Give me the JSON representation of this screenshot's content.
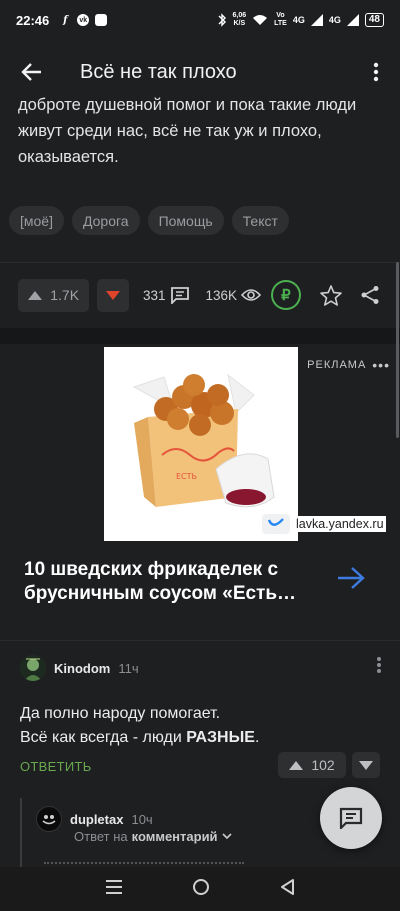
{
  "status_bar": {
    "time": "22:46",
    "speed": "6,06",
    "speed_unit": "K/S",
    "volte_top": "Vo",
    "volte_bottom": "LTE",
    "net1": "4G",
    "net2": "4G",
    "battery": "48"
  },
  "header": {
    "title": "Всё не так плохо"
  },
  "post": {
    "text": "доброте душевной помог и пока такие люди живут среди нас, всё не так уж и плохо, оказывается.",
    "tags": [
      "[моё]",
      "Дорога",
      "Помощь",
      "Текст"
    ],
    "rating": "1.7K",
    "comments": "331",
    "views": "136K",
    "donate_symbol": "₽"
  },
  "ad": {
    "label": "РЕКЛАМА",
    "domain": "lavka.yandex.ru",
    "title": "10 шведских фрикаделек с брусничным соусом «Есть…"
  },
  "comment": {
    "user": "Kinodom",
    "time": "11ч",
    "body_line1": "Да полно народу помогает.",
    "body_line2_prefix": "Всё как всегда - люди ",
    "body_line2_bold": "РАЗНЫЕ",
    "body_line2_suffix": ".",
    "reply_label": "ОТВЕТИТЬ",
    "rating": "102"
  },
  "reply": {
    "user": "dupletax",
    "time": "10ч",
    "reply_to_prefix": "Ответ на",
    "reply_to_target": "комментарий"
  },
  "colors": {
    "background": "#1e1f21",
    "accent_green": "#4caf50",
    "downvote_red": "#e0442a",
    "arrow_blue": "#3d7be0"
  }
}
